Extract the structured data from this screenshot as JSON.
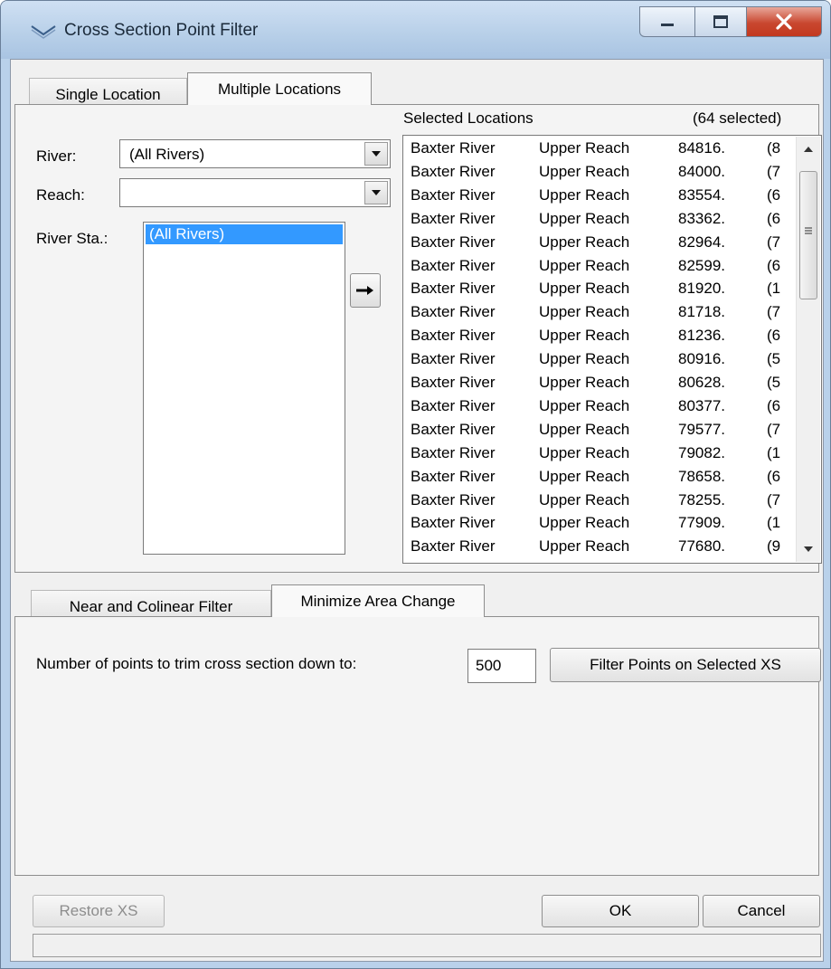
{
  "window": {
    "title": "Cross Section Point Filter"
  },
  "top_tabs": [
    {
      "label": "Single Location",
      "active": false
    },
    {
      "label": "Multiple Locations",
      "active": true
    }
  ],
  "left": {
    "river_label": "River:",
    "river_value": "(All Rivers)",
    "reach_label": "Reach:",
    "reach_value": "",
    "station_label": "River Sta.:",
    "station_items": [
      "(All Rivers)"
    ]
  },
  "selected": {
    "header": "Selected Locations",
    "count": "(64 selected)",
    "rows": [
      [
        "Baxter River",
        "Upper Reach",
        "84816.",
        "(8"
      ],
      [
        "Baxter River",
        "Upper Reach",
        "84000.",
        "(7"
      ],
      [
        "Baxter River",
        "Upper Reach",
        "83554.",
        "(6"
      ],
      [
        "Baxter River",
        "Upper Reach",
        "83362.",
        "(6"
      ],
      [
        "Baxter River",
        "Upper Reach",
        "82964.",
        "(7"
      ],
      [
        "Baxter River",
        "Upper Reach",
        "82599.",
        "(6"
      ],
      [
        "Baxter River",
        "Upper Reach",
        "81920.",
        "(1"
      ],
      [
        "Baxter River",
        "Upper Reach",
        "81718.",
        "(7"
      ],
      [
        "Baxter River",
        "Upper Reach",
        "81236.",
        "(6"
      ],
      [
        "Baxter River",
        "Upper Reach",
        "80916.",
        "(5"
      ],
      [
        "Baxter River",
        "Upper Reach",
        "80628.",
        "(5"
      ],
      [
        "Baxter River",
        "Upper Reach",
        "80377.",
        "(6"
      ],
      [
        "Baxter River",
        "Upper Reach",
        "79577.",
        "(7"
      ],
      [
        "Baxter River",
        "Upper Reach",
        "79082.",
        "(1"
      ],
      [
        "Baxter River",
        "Upper Reach",
        "78658.",
        "(6"
      ],
      [
        "Baxter River",
        "Upper Reach",
        "78255.",
        "(7"
      ],
      [
        "Baxter River",
        "Upper Reach",
        "77909.",
        "(1"
      ],
      [
        "Baxter River",
        "Upper Reach",
        "77680.",
        "(9"
      ]
    ]
  },
  "bottom_tabs": [
    {
      "label": "Near and Colinear Filter",
      "active": false
    },
    {
      "label": "Minimize Area Change",
      "active": true
    }
  ],
  "minimize": {
    "points_label": "Number of points to trim cross section down to:",
    "points_value": "500",
    "filter_button": "Filter Points on Selected XS"
  },
  "footer": {
    "restore_button": "Restore XS",
    "ok_button": "OK",
    "cancel_button": "Cancel",
    "status_text": ""
  }
}
